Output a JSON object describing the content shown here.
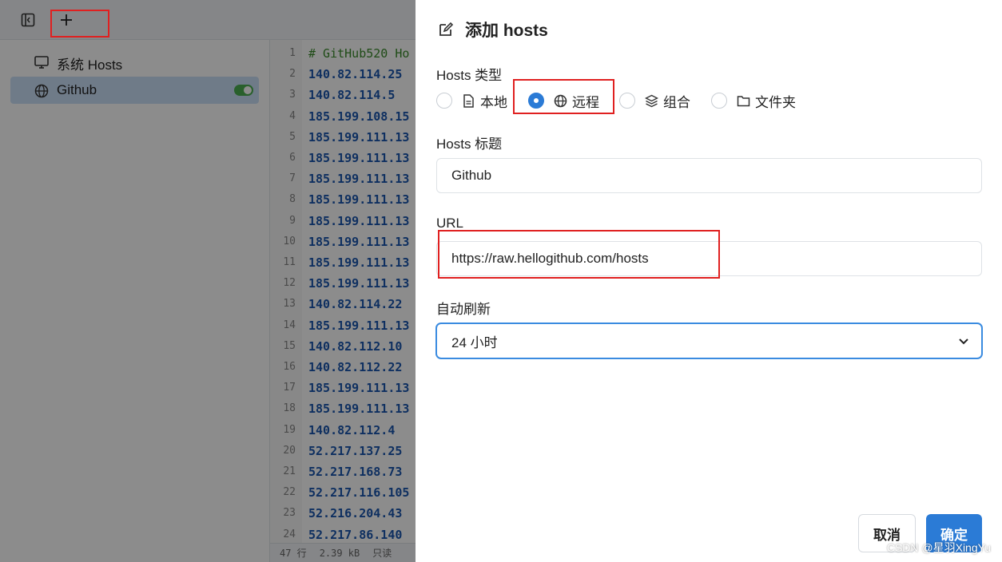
{
  "sidebar": {
    "items": [
      {
        "label": "系统 Hosts",
        "icon": "monitor-icon"
      },
      {
        "label": "Github",
        "icon": "globe-icon",
        "enabled": true
      }
    ]
  },
  "editor": {
    "line_numbers": [
      "1",
      "2",
      "3",
      "4",
      "5",
      "6",
      "7",
      "8",
      "9",
      "10",
      "11",
      "12",
      "13",
      "14",
      "15",
      "16",
      "17",
      "18",
      "19",
      "20",
      "21",
      "22",
      "23",
      "24"
    ],
    "lines": [
      "# GitHub520 Ho",
      "140.82.114.25",
      "140.82.114.5",
      "185.199.108.15",
      "185.199.111.13",
      "185.199.111.13",
      "185.199.111.13",
      "185.199.111.13",
      "185.199.111.13",
      "185.199.111.13",
      "185.199.111.13",
      "185.199.111.13",
      "140.82.114.22",
      "185.199.111.13",
      "140.82.112.10",
      "140.82.112.22",
      "185.199.111.13",
      "185.199.111.13",
      "140.82.112.4",
      "52.217.137.25",
      "52.217.168.73",
      "52.217.116.105",
      "52.216.204.43",
      "52.217.86.140"
    ],
    "status": {
      "lines": "47 行",
      "size": "2.39 kB",
      "mode": "只读"
    }
  },
  "drawer": {
    "title": "添加 hosts",
    "type_label": "Hosts 类型",
    "types": [
      {
        "label": "本地",
        "icon": "file-icon",
        "checked": false
      },
      {
        "label": "远程",
        "icon": "globe-icon",
        "checked": true
      },
      {
        "label": "组合",
        "icon": "layers-icon",
        "checked": false
      },
      {
        "label": "文件夹",
        "icon": "folder-icon",
        "checked": false
      }
    ],
    "title_label": "Hosts 标题",
    "title_value": "Github",
    "url_label": "URL",
    "url_value": "https://raw.hellogithub.com/hosts",
    "refresh_label": "自动刷新",
    "refresh_value": "24 小时",
    "cancel_label": "取消",
    "ok_label": "确定"
  },
  "watermark": "CSDN @星羽XingYu",
  "colors": {
    "accent": "#2b7bd6",
    "annotation": "#e02020",
    "toggle_on": "#4caf50"
  }
}
